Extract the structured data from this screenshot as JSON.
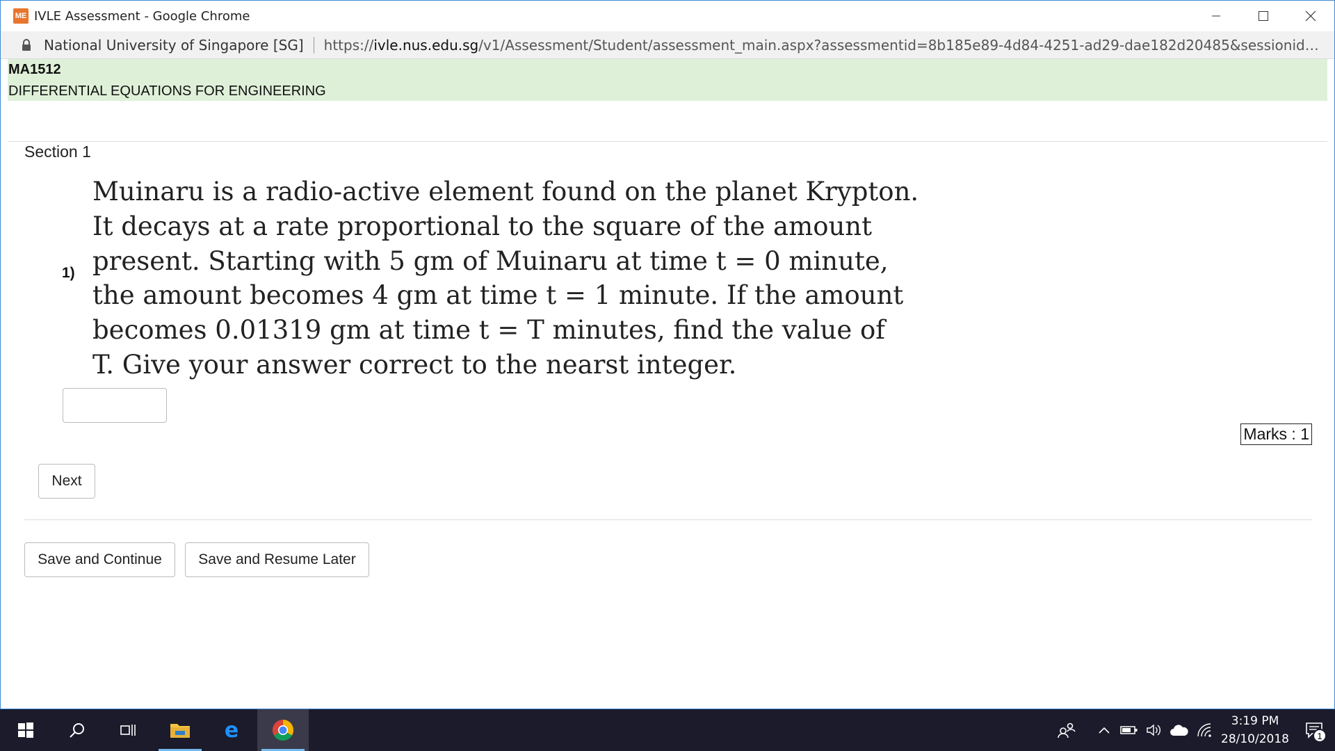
{
  "window": {
    "app_icon_text": "ME",
    "title": "IVLE Assessment - Google Chrome"
  },
  "address": {
    "site_name": "National University of Singapore [SG]",
    "url_scheme": "https://",
    "url_host": "ivle.nus.edu.sg",
    "url_path": "/v1/Assessment/Student/assessment_main.aspx?assessmentid=8b185e89-4d84-4251-ad29-dae182d20485&sessionid=04bb417a-e0..."
  },
  "course": {
    "code": "MA1512",
    "name": "DIFFERENTIAL EQUATIONS FOR ENGINEERING"
  },
  "section": {
    "title": "Section 1"
  },
  "question": {
    "number": "1)",
    "lines": [
      "Muinaru is a radio-active element found on the planet Krypton.",
      "It decays at a rate proportional to the square of the amount",
      "present. Starting with 5 gm of Muinaru at time t = 0 minute,",
      "the amount becomes 4 gm at time t = 1 minute. If the amount",
      "becomes 0.01319 gm at time t = T minutes, find the value of",
      "T. Give your answer correct to the nearst integer."
    ],
    "answer_value": "",
    "marks": "Marks : 1"
  },
  "buttons": {
    "next": "Next",
    "save_continue": "Save and Continue",
    "save_later": "Save and Resume Later"
  },
  "taskbar": {
    "time": "3:19 PM",
    "date": "28/10/2018",
    "notification_count": "1"
  },
  "colors": {
    "course_header_bg": "#dff0d8",
    "window_border": "#3c8bd9",
    "taskbar_bg": "#1b1b2b"
  }
}
